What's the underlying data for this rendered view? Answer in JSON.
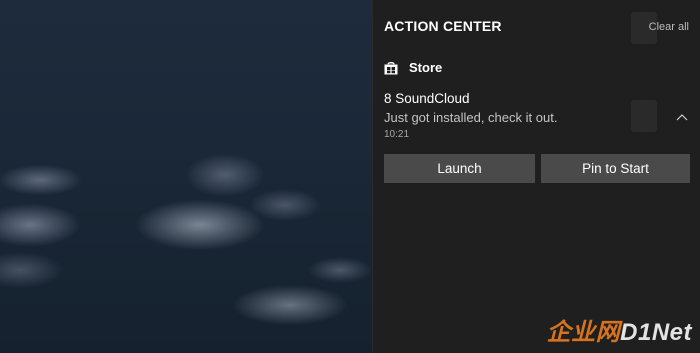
{
  "action_center": {
    "title": "ACTION CENTER",
    "clear_all": "Clear all",
    "app_group": {
      "name": "Store",
      "icon": "store-icon"
    },
    "notification": {
      "title": "8 SoundCloud",
      "body": "Just got installed, check it out.",
      "time": "10:21",
      "buttons": {
        "launch": "Launch",
        "pin": "Pin to Start"
      }
    }
  },
  "watermark": {
    "cn": "企业网",
    "brand": "D1Net"
  },
  "colors": {
    "panel_bg": "#1f1f1f",
    "button_bg": "#4a4a4a",
    "muted_text": "#c4c4c4",
    "watermark_accent": "#e67b1c"
  }
}
